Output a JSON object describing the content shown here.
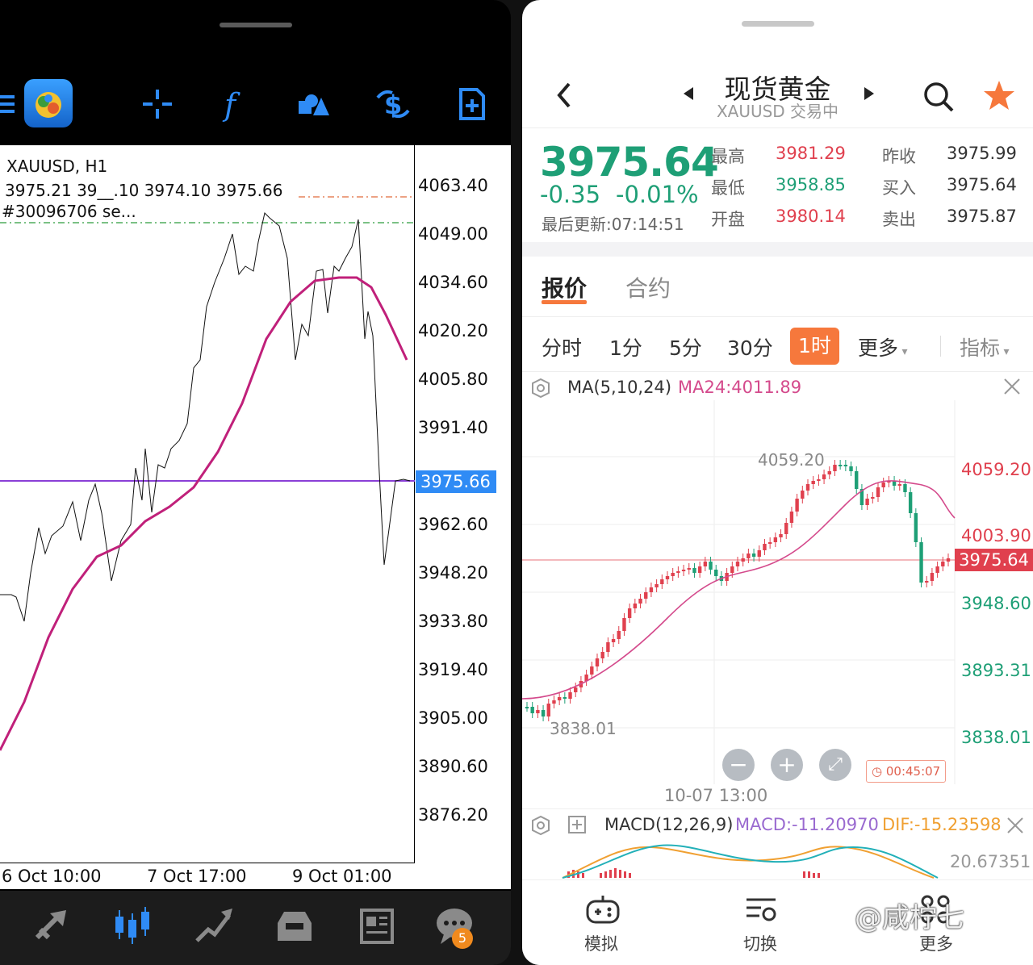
{
  "left": {
    "toolbar": [
      "menu-icon",
      "app-logo",
      "crosshair-icon",
      "indicator-f-icon",
      "objects-icon",
      "trade-dollar-icon",
      "new-order-icon"
    ],
    "chart": {
      "symbol_line": "XAUUSD, H1",
      "ohlc_line": "3975.21 39__.10 3974.10 3975.66",
      "order_line": "#30096706 se..."
    },
    "price_axis": [
      "4063.40",
      "4049.00",
      "4034.60",
      "4020.20",
      "4005.80",
      "3991.40",
      "3975.66",
      "3962.60",
      "3948.20",
      "3933.80",
      "3919.40",
      "3905.00",
      "3890.60",
      "3876.20"
    ],
    "current_price": "3975.66",
    "time_axis": [
      "6 Oct 10:00",
      "7 Oct 17:00",
      "9 Oct 01:00"
    ],
    "bottom_nav": [
      "quotes-icon",
      "chart-icon",
      "trade-icon",
      "history-icon",
      "news-icon",
      "chat-icon"
    ],
    "chat_badge": "5",
    "colors": {
      "price_line": "#000000",
      "ma_line": "#c0207a",
      "current_line": "#8a3fd6",
      "accent": "#2f8bf5"
    }
  },
  "right": {
    "header": {
      "title": "现货黄金",
      "subtitle": "XAUUSD 交易中"
    },
    "quote": {
      "price": "3975.64",
      "change": "-0.35",
      "change_pct": "-0.01%",
      "updated": "最后更新:07:14:51",
      "high_label": "最高",
      "high": "3981.29",
      "low_label": "最低",
      "low": "3958.85",
      "open_label": "开盘",
      "open": "3980.14",
      "prev_label": "昨收",
      "prev": "3975.99",
      "bid_label": "买入",
      "bid": "3975.64",
      "ask_label": "卖出",
      "ask": "3975.87"
    },
    "tabs": [
      "报价",
      "合约"
    ],
    "periods": [
      "分时",
      "1分",
      "5分",
      "30分",
      "1时",
      "更多",
      "指标"
    ],
    "ma": {
      "label": "MA(5,10,24)",
      "value": "MA24:4011.89"
    },
    "chart": {
      "axis": [
        "4059.20",
        "4003.90",
        "3975.64",
        "3948.60",
        "3893.31",
        "3838.01"
      ],
      "high_marker": "4059.20",
      "low_marker": "3838.01",
      "time": "10-07 13:00",
      "timer": "00:45:07"
    },
    "macd": {
      "label": "MACD(12,26,9)",
      "macd": "MACD:-11.20970",
      "dif": "DIF:-15.23598",
      "axis": "20.67351"
    },
    "nav": [
      "模拟",
      "切换",
      "更多"
    ],
    "watermark": "@咸柠七",
    "colors": {
      "up": "#e0404e",
      "down": "#1e9f76",
      "accent": "#f6783c",
      "ma": "#d44a8c"
    }
  }
}
